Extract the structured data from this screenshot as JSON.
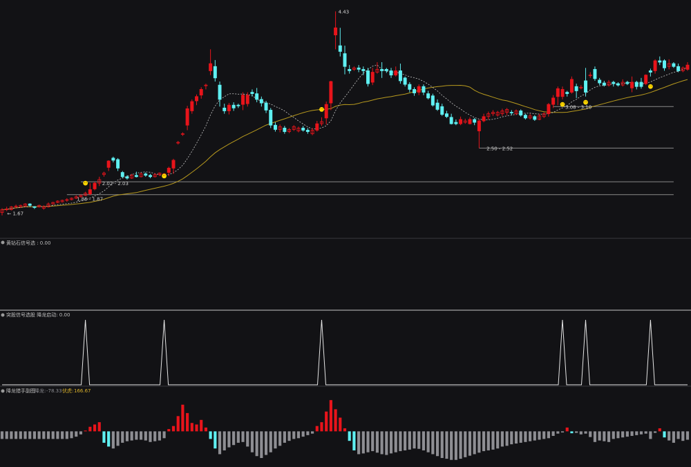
{
  "colors": {
    "background": "#121215",
    "up": "#e8141b",
    "down": "#5ff0f2",
    "ma_fast": "#c9c9c9",
    "ma_slow": "#b89a1e",
    "level_line": "#8a8a8a",
    "signal_line": "#e6e6e6",
    "divider": "#3a3a40",
    "marker": "#ffd800",
    "neg_bar": "#8e8e93",
    "title_text": "#bfbfbf",
    "value_red": "#c9494b",
    "value_gray": "#8e8e93",
    "value_gold": "#d9b12c"
  },
  "panels": {
    "p2_title": "黄钻石信号选 : 0.00",
    "p3_title": "突股信号选股 降龙启动: 0.00",
    "p4_title": "降龙猎手副图",
    "p4_label_a": "降龙:",
    "p4_value_a": "-78.33",
    "p4_label_b": "伏虎:",
    "p4_value_b": "166.67"
  },
  "chart_data": {
    "type": "candlestick",
    "main": {
      "candles": [
        [
          1.62,
          1.66,
          1.58,
          1.68
        ],
        [
          1.66,
          1.67,
          1.64,
          1.7
        ],
        [
          1.66,
          1.7,
          1.65,
          1.71
        ],
        [
          1.7,
          1.71,
          1.68,
          1.73
        ],
        [
          1.7,
          1.72,
          1.69,
          1.73
        ],
        [
          1.71,
          1.74,
          1.7,
          1.75
        ],
        [
          1.74,
          1.72,
          1.7,
          1.75
        ],
        [
          1.7,
          1.69,
          1.67,
          1.71
        ],
        [
          1.7,
          1.72,
          1.69,
          1.73
        ],
        [
          1.68,
          1.7,
          1.66,
          1.72
        ],
        [
          1.7,
          1.74,
          1.69,
          1.76
        ],
        [
          1.74,
          1.76,
          1.73,
          1.77
        ],
        [
          1.76,
          1.78,
          1.75,
          1.79
        ],
        [
          1.77,
          1.79,
          1.76,
          1.8
        ],
        [
          1.79,
          1.8,
          1.77,
          1.82
        ],
        [
          1.8,
          1.82,
          1.79,
          1.83
        ],
        [
          1.82,
          1.84,
          1.81,
          1.86
        ],
        [
          1.84,
          1.86,
          1.83,
          1.87
        ],
        [
          1.86,
          1.89,
          1.85,
          1.91
        ],
        [
          1.88,
          1.94,
          1.86,
          2.03
        ],
        [
          1.95,
          2.03,
          1.93,
          2.05
        ],
        [
          2.03,
          2.08,
          1.99,
          2.12
        ],
        [
          2.15,
          2.17,
          2.12,
          2.19
        ],
        [
          2.25,
          2.34,
          2.2,
          2.35
        ],
        [
          2.38,
          2.35,
          2.32,
          2.4
        ],
        [
          2.36,
          2.24,
          2.2,
          2.38
        ],
        [
          2.18,
          2.12,
          2.1,
          2.2
        ],
        [
          2.12,
          2.1,
          2.08,
          2.14
        ],
        [
          2.1,
          2.14,
          2.09,
          2.16
        ],
        [
          2.14,
          2.12,
          2.11,
          2.19
        ],
        [
          2.12,
          2.16,
          2.11,
          2.18
        ],
        [
          2.16,
          2.14,
          2.12,
          2.18
        ],
        [
          2.14,
          2.12,
          2.1,
          2.16
        ],
        [
          2.12,
          2.15,
          2.11,
          2.17
        ],
        [
          2.15,
          2.17,
          2.13,
          2.18
        ],
        [
          2.14,
          2.16,
          2.12,
          2.17
        ],
        [
          2.18,
          2.24,
          2.13,
          2.26
        ],
        [
          2.24,
          2.35,
          2.16,
          2.37
        ],
        [
          2.6,
          2.6,
          2.57,
          2.62
        ],
        [
          2.72,
          2.72,
          2.69,
          2.74
        ],
        [
          2.84,
          3.07,
          2.77,
          3.11
        ],
        [
          3.04,
          3.17,
          3.0,
          3.2
        ],
        [
          3.18,
          3.24,
          3.12,
          3.27
        ],
        [
          3.26,
          3.34,
          3.21,
          3.37
        ],
        [
          3.4,
          3.4,
          3.34,
          3.42
        ],
        [
          3.6,
          3.7,
          3.54,
          3.9
        ],
        [
          3.66,
          3.5,
          3.45,
          3.75
        ],
        [
          3.4,
          3.2,
          3.1,
          3.45
        ],
        [
          3.08,
          3.04,
          3.0,
          3.14
        ],
        [
          3.04,
          3.12,
          2.99,
          3.15
        ],
        [
          3.12,
          3.08,
          3.04,
          3.16
        ],
        [
          3.12,
          3.11,
          3.08,
          3.14
        ],
        [
          3.13,
          3.26,
          3.05,
          3.3
        ],
        [
          3.14,
          3.26,
          3.1,
          3.3
        ],
        [
          3.3,
          3.28,
          3.24,
          3.34
        ],
        [
          3.28,
          3.2,
          3.16,
          3.36
        ],
        [
          3.2,
          3.15,
          3.1,
          3.24
        ],
        [
          3.15,
          3.05,
          3.01,
          3.18
        ],
        [
          3.05,
          2.84,
          2.8,
          3.08
        ],
        [
          2.84,
          2.78,
          2.75,
          2.88
        ],
        [
          2.78,
          2.82,
          2.74,
          2.85
        ],
        [
          2.8,
          2.75,
          2.72,
          2.83
        ],
        [
          2.75,
          2.78,
          2.73,
          2.8
        ],
        [
          2.78,
          2.82,
          2.76,
          2.84
        ],
        [
          2.76,
          2.8,
          2.74,
          2.82
        ],
        [
          2.8,
          2.77,
          2.75,
          2.83
        ],
        [
          2.77,
          2.75,
          2.72,
          2.8
        ],
        [
          2.72,
          2.77,
          2.7,
          2.8
        ],
        [
          2.77,
          2.86,
          2.75,
          2.9
        ],
        [
          2.86,
          2.89,
          2.83,
          2.95
        ],
        [
          2.94,
          3.13,
          2.85,
          3.17
        ],
        [
          3.15,
          3.45,
          3.05,
          3.46
        ],
        [
          4.1,
          4.2,
          3.9,
          4.43
        ],
        [
          3.95,
          3.87,
          3.8,
          4.2
        ],
        [
          3.84,
          3.66,
          3.55,
          3.95
        ],
        [
          3.62,
          3.6,
          3.56,
          3.68
        ],
        [
          3.62,
          3.64,
          3.6,
          3.66
        ],
        [
          3.64,
          3.62,
          3.58,
          3.68
        ],
        [
          3.62,
          3.6,
          3.54,
          3.66
        ],
        [
          3.6,
          3.42,
          3.38,
          3.64
        ],
        [
          3.44,
          3.58,
          3.4,
          3.64
        ],
        [
          3.58,
          3.62,
          3.56,
          3.72
        ],
        [
          3.62,
          3.6,
          3.5,
          3.72
        ],
        [
          3.62,
          3.6,
          3.57,
          3.64
        ],
        [
          3.6,
          3.54,
          3.5,
          3.64
        ],
        [
          3.54,
          3.6,
          3.52,
          3.66
        ],
        [
          3.6,
          3.46,
          3.42,
          3.7
        ],
        [
          3.5,
          3.41,
          3.38,
          3.52
        ],
        [
          3.41,
          3.34,
          3.3,
          3.44
        ],
        [
          3.34,
          3.29,
          3.25,
          3.37
        ],
        [
          3.3,
          3.38,
          3.26,
          3.41
        ],
        [
          3.38,
          3.3,
          3.26,
          3.41
        ],
        [
          3.28,
          3.22,
          3.2,
          3.32
        ],
        [
          3.25,
          3.12,
          3.1,
          3.28
        ],
        [
          3.15,
          3.06,
          3.04,
          3.2
        ],
        [
          3.1,
          2.99,
          2.97,
          3.14
        ],
        [
          3.0,
          2.96,
          2.94,
          3.04
        ],
        [
          2.95,
          2.86,
          2.85,
          3.0
        ],
        [
          2.88,
          2.86,
          2.84,
          2.92
        ],
        [
          2.86,
          2.92,
          2.84,
          2.96
        ],
        [
          2.88,
          2.9,
          2.86,
          2.93
        ],
        [
          2.86,
          2.92,
          2.85,
          2.95
        ],
        [
          2.92,
          2.88,
          2.84,
          2.94
        ],
        [
          2.76,
          2.9,
          2.52,
          2.92
        ],
        [
          2.9,
          2.96,
          2.88,
          3.0
        ],
        [
          2.96,
          3.0,
          2.92,
          3.03
        ],
        [
          3.0,
          3.02,
          2.97,
          3.05
        ],
        [
          2.98,
          3.02,
          2.96,
          3.04
        ],
        [
          3.0,
          3.04,
          2.97,
          3.07
        ],
        [
          3.02,
          3.06,
          2.98,
          3.08
        ],
        [
          3.02,
          3.01,
          2.98,
          3.05
        ],
        [
          3.0,
          3.04,
          2.98,
          3.06
        ],
        [
          3.04,
          2.98,
          2.96,
          3.06
        ],
        [
          2.98,
          2.94,
          2.92,
          3.0
        ],
        [
          2.94,
          2.97,
          2.92,
          3.0
        ],
        [
          2.96,
          2.92,
          2.9,
          2.98
        ],
        [
          2.92,
          2.97,
          2.91,
          3.0
        ],
        [
          2.96,
          3.0,
          2.94,
          3.02
        ],
        [
          3.0,
          3.13,
          2.96,
          3.15
        ],
        [
          3.13,
          3.22,
          3.08,
          3.26
        ],
        [
          3.24,
          3.35,
          3.12,
          3.38
        ],
        [
          3.24,
          3.34,
          3.2,
          3.38
        ],
        [
          3.3,
          3.28,
          3.24,
          3.32
        ],
        [
          3.3,
          3.48,
          3.28,
          3.52
        ],
        [
          3.38,
          3.32,
          3.22,
          3.42
        ],
        [
          3.36,
          3.37,
          3.34,
          3.4
        ],
        [
          3.46,
          3.3,
          3.24,
          3.64
        ],
        [
          3.54,
          3.54,
          3.5,
          3.58
        ],
        [
          3.62,
          3.49,
          3.46,
          3.66
        ],
        [
          3.47,
          3.43,
          3.4,
          3.5
        ],
        [
          3.43,
          3.4,
          3.38,
          3.46
        ],
        [
          3.4,
          3.44,
          3.38,
          3.47
        ],
        [
          3.44,
          3.42,
          3.38,
          3.46
        ],
        [
          3.42,
          3.4,
          3.38,
          3.44
        ],
        [
          3.4,
          3.44,
          3.38,
          3.48
        ],
        [
          3.44,
          3.42,
          3.4,
          3.46
        ],
        [
          3.36,
          3.44,
          3.3,
          3.52
        ],
        [
          3.44,
          3.38,
          3.34,
          3.46
        ],
        [
          3.44,
          3.38,
          3.35,
          3.5
        ],
        [
          3.42,
          3.54,
          3.4,
          3.55
        ],
        [
          3.6,
          3.58,
          3.52,
          3.63
        ],
        [
          3.6,
          3.74,
          3.56,
          3.76
        ],
        [
          3.74,
          3.72,
          3.68,
          3.8
        ],
        [
          3.74,
          3.64,
          3.6,
          3.76
        ],
        [
          3.66,
          3.7,
          3.62,
          3.76
        ],
        [
          3.7,
          3.66,
          3.64,
          3.72
        ],
        [
          3.66,
          3.6,
          3.58,
          3.7
        ],
        [
          3.6,
          3.64,
          3.58,
          3.66
        ],
        [
          3.62,
          3.68,
          3.6,
          3.72
        ]
      ],
      "labels": [
        {
          "i": 2,
          "p": 1.67,
          "text": "← 1.67",
          "pos": "below"
        },
        {
          "i": 21,
          "p": 2.03,
          "text": "2.02 - 2.03",
          "pos": "right"
        },
        {
          "i": 17,
          "p": 1.87,
          "text": "1.86 - 1.87",
          "pos": "below"
        },
        {
          "i": 72,
          "p": 4.43,
          "text": "4.43",
          "pos": "right"
        },
        {
          "i": 104,
          "p": 2.52,
          "text": "2.50 - 2.52",
          "pos": "right"
        },
        {
          "i": 121,
          "p": 3.1,
          "text": "3.08 - 3.10",
          "pos": "right"
        }
      ],
      "hlines": [
        {
          "p": 2.05,
          "from_i": 17,
          "to_i": 145
        },
        {
          "p": 1.87,
          "from_i": 14,
          "to_i": 145
        },
        {
          "p": 2.52,
          "from_i": 103,
          "to_i": 145
        },
        {
          "p": 3.1,
          "from_i": 119,
          "to_i": 145
        }
      ],
      "smileys": [
        {
          "i": 18,
          "p": 2.03
        },
        {
          "i": 35,
          "p": 2.13
        },
        {
          "i": 69,
          "p": 3.06
        },
        {
          "i": 121,
          "p": 3.13
        },
        {
          "i": 126,
          "p": 3.16
        },
        {
          "i": 140,
          "p": 3.38
        }
      ],
      "ylim": [
        1.52,
        4.55
      ]
    },
    "signal": {
      "type": "line",
      "peaks_at": [
        18,
        35,
        69,
        121,
        126,
        140
      ],
      "ylim": [
        0,
        1
      ]
    },
    "histogram": {
      "type": "bar",
      "values": [
        -20,
        -20,
        -20,
        -20,
        -20,
        -20,
        -20,
        -20,
        -20,
        -20,
        -20,
        -20,
        -20,
        -20,
        -20,
        -18,
        -14,
        -8,
        2,
        12,
        18,
        24,
        -30,
        -40,
        -45,
        -38,
        -30,
        -26,
        -24,
        -22,
        -22,
        -24,
        -28,
        -26,
        -24,
        -18,
        6,
        14,
        40,
        70,
        48,
        22,
        18,
        30,
        10,
        -20,
        -45,
        -60,
        -50,
        -42,
        -36,
        -30,
        -28,
        -40,
        -55,
        -65,
        -70,
        -62,
        -55,
        -45,
        -38,
        -30,
        -25,
        -20,
        -18,
        -14,
        -10,
        -6,
        14,
        24,
        52,
        82,
        58,
        36,
        8,
        -25,
        -50,
        -60,
        -58,
        -55,
        -52,
        -56,
        -60,
        -62,
        -58,
        -55,
        -52,
        -50,
        -48,
        -45,
        -46,
        -50,
        -55,
        -60,
        -65,
        -70,
        -72,
        -75,
        -75,
        -72,
        -68,
        -64,
        -60,
        -56,
        -52,
        -50,
        -48,
        -45,
        -40,
        -38,
        -34,
        -32,
        -30,
        -28,
        -26,
        -24,
        -22,
        -20,
        -18,
        -12,
        -6,
        -3,
        10,
        -5,
        -4,
        -8,
        -6,
        -15,
        -28,
        -24,
        -26,
        -28,
        -20,
        -18,
        -16,
        -14,
        -12,
        -10,
        -8,
        -6,
        -20,
        -4,
        8,
        -16,
        -24,
        -30,
        -20,
        -25,
        -22
      ],
      "ylim": [
        -90,
        95
      ]
    }
  }
}
